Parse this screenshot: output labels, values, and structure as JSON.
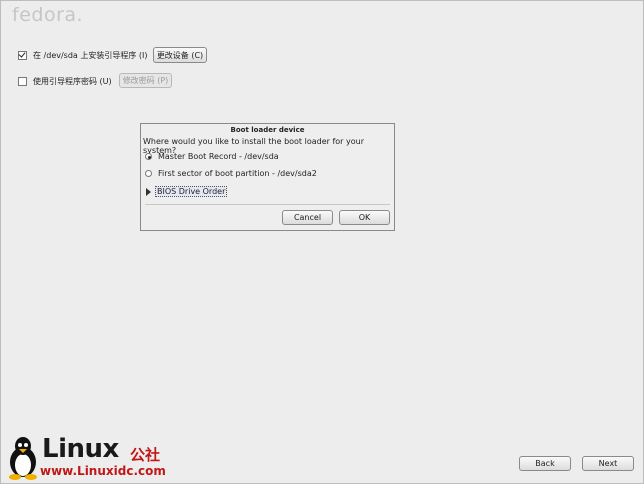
{
  "brand": {
    "logo": "fedora."
  },
  "options": {
    "install_bootloader": {
      "label": "在 /dev/sda 上安装引导程序 (I)",
      "checked": true,
      "button": "更改设备 (C)"
    },
    "bootloader_password": {
      "label": "使用引导程序密码 (U)",
      "checked": false,
      "button": "修改密码 (P)"
    }
  },
  "dialog": {
    "title": "Boot loader device",
    "question": "Where would you like to install the boot loader for your system?",
    "choices": [
      {
        "label": "Master Boot Record - /dev/sda",
        "selected": true
      },
      {
        "label": "First sector of boot partition - /dev/sda2",
        "selected": false
      }
    ],
    "expander_label": "BIOS Drive Order",
    "cancel_label": "Cancel",
    "ok_label": "OK"
  },
  "footer": {
    "back_label": "Back",
    "next_label": "Next"
  },
  "watermark": {
    "brand": "Linux",
    "brand_cn": "公社",
    "url": "www.Linuxidc.com"
  }
}
